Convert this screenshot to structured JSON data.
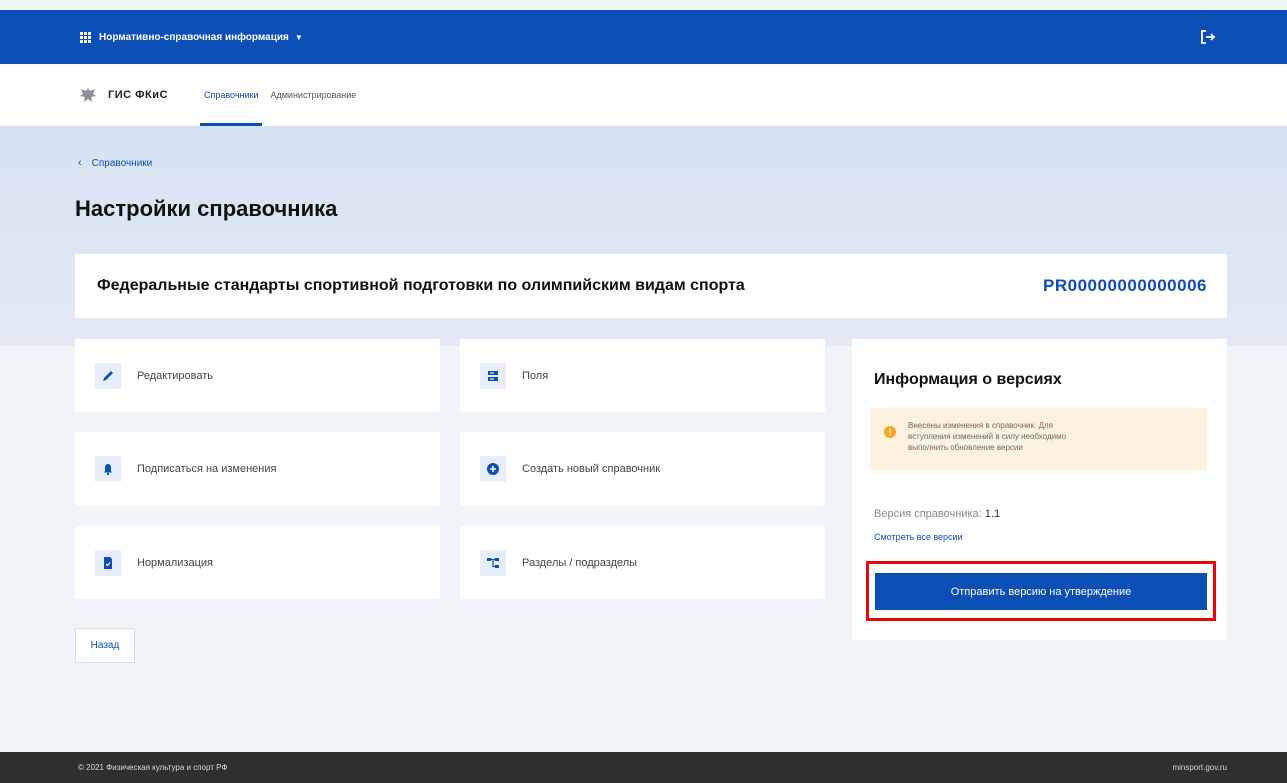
{
  "topbar": {
    "app_switcher": "Нормативно-справочная информация"
  },
  "header": {
    "logo": "ГИС ФКиС",
    "nav": [
      "Справочники",
      "Администрирование"
    ]
  },
  "breadcrumb": "Справочники",
  "page_title": "Настройки справочника",
  "dictionary": {
    "name": "Федеральные стандарты спортивной подготовки по олимпийским видам спорта",
    "code": "PR00000000000006"
  },
  "actions": {
    "edit": "Редактировать",
    "fields": "Поля",
    "subscribe": "Подписаться на изменения",
    "create": "Создать новый справочник",
    "normalize": "Нормализация",
    "sections": "Разделы / подразделы"
  },
  "versions": {
    "title": "Информация о версиях",
    "notice": "Внесены изменения в справочник. Для вступления изменений в силу необходимо выполнить обновление версии",
    "version_label": "Версия справочника:",
    "version_value": "1.1",
    "all_versions_link": "Смотреть все версии",
    "send_button": "Отправить версию на утверждение"
  },
  "back_button": "Назад",
  "footer": {
    "copyright": "© 2021 Физическая культура и спорт РФ",
    "site": "minsport.gov.ru"
  },
  "colors": {
    "primary": "#0b4fb6",
    "highlight": "#e8060b",
    "warning": "#f5a623"
  },
  "icons": {
    "edit": "pencil-icon",
    "fields": "fields-icon",
    "subscribe": "bell-icon",
    "create": "plus-circle-icon",
    "normalize": "document-icon",
    "sections": "hierarchy-icon",
    "logout": "logout-icon"
  }
}
